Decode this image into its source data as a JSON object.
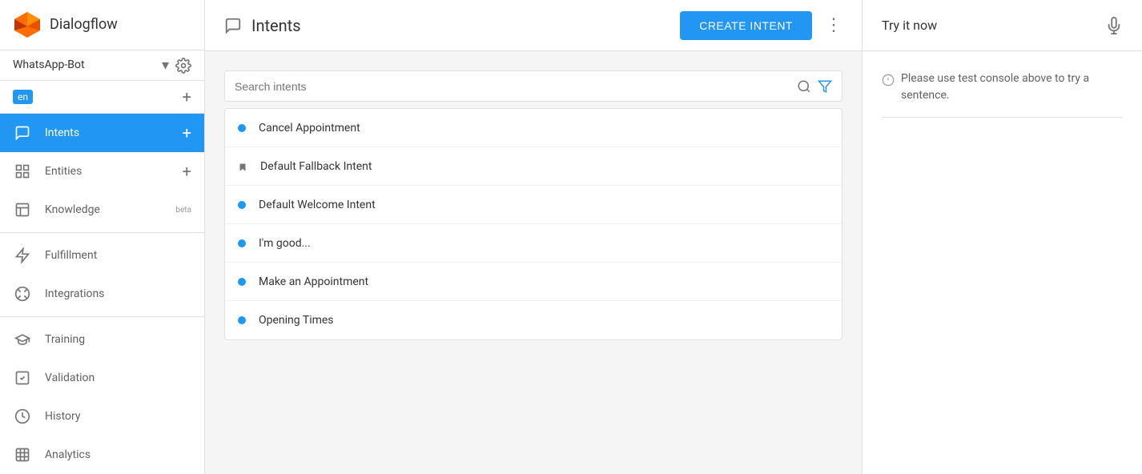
{
  "app": {
    "name": "Dialogflow"
  },
  "agent": {
    "name": "WhatsApp-Bot",
    "language": "en"
  },
  "sidebar": {
    "items": [
      {
        "id": "intents",
        "label": "Intents",
        "active": true,
        "has_add": true
      },
      {
        "id": "entities",
        "label": "Entities",
        "active": false,
        "has_add": true
      },
      {
        "id": "knowledge",
        "label": "Knowledge",
        "active": false,
        "badge": "beta"
      },
      {
        "id": "fulfillment",
        "label": "Fulfillment",
        "active": false
      },
      {
        "id": "integrations",
        "label": "Integrations",
        "active": false
      },
      {
        "id": "training",
        "label": "Training",
        "active": false
      },
      {
        "id": "validation",
        "label": "Validation",
        "active": false
      },
      {
        "id": "history",
        "label": "History",
        "active": false
      },
      {
        "id": "analytics",
        "label": "Analytics",
        "active": false
      }
    ]
  },
  "header": {
    "title": "Intents",
    "create_button_label": "CREATE INTENT"
  },
  "search": {
    "placeholder": "Search intents"
  },
  "intents": [
    {
      "id": 1,
      "name": "Cancel Appointment",
      "type": "dot"
    },
    {
      "id": 2,
      "name": "Default Fallback Intent",
      "type": "bookmark"
    },
    {
      "id": 3,
      "name": "Default Welcome Intent",
      "type": "dot"
    },
    {
      "id": 4,
      "name": "I'm good...",
      "type": "dot"
    },
    {
      "id": 5,
      "name": "Make an Appointment",
      "type": "dot"
    },
    {
      "id": 6,
      "name": "Opening Times",
      "type": "dot"
    }
  ],
  "right_panel": {
    "title": "Try it now",
    "info_text": "Please use test console above to try a sentence."
  },
  "colors": {
    "primary": "#2196F3",
    "text_dark": "#333333",
    "text_medium": "#616161",
    "text_light": "#757575",
    "border": "#e0e0e0",
    "bg_active": "#2196F3"
  }
}
